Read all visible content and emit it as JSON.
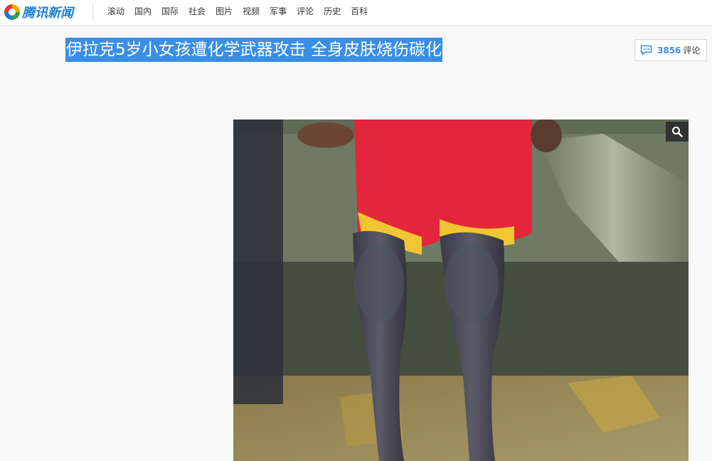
{
  "header": {
    "logo_text": "腾讯新闻",
    "logo_icon": "tencent-news-logo",
    "nav": [
      {
        "label": "滚动"
      },
      {
        "label": "国内"
      },
      {
        "label": "国际"
      },
      {
        "label": "社会"
      },
      {
        "label": "图片"
      },
      {
        "label": "视频"
      },
      {
        "label": "军事"
      },
      {
        "label": "评论"
      },
      {
        "label": "历史"
      },
      {
        "label": "百科"
      }
    ]
  },
  "article": {
    "title": "伊拉克5岁小女孩遭化学武器攻击 全身皮肤烧伤碳化",
    "comments": {
      "count": "3856",
      "label": "评论",
      "icon": "comment-bubble-icon"
    },
    "photo": {
      "zoom_icon": "magnifier-icon"
    }
  },
  "colors": {
    "accent": "#3a8ee6",
    "title_highlight": "#3a8ee6",
    "page_bg": "#f8f8f8"
  }
}
